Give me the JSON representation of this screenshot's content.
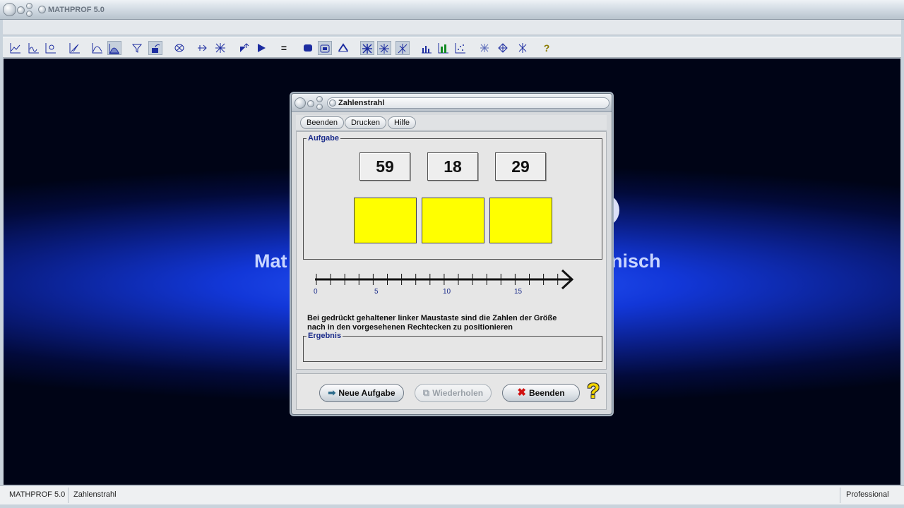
{
  "app": {
    "title": "MATHPROF 5.0"
  },
  "background": {
    "title_left": "Mat",
    "title_right": "nisch"
  },
  "toolbar": {
    "icons": [
      "graph-line-icon",
      "graph-multi-icon",
      "graph-param-icon",
      "graph-axes-icon",
      "graph-curve-icon",
      "graph-area-icon",
      "filter-icon",
      "rotate-icon",
      "ellipse-cross-icon",
      "arrow-cross-icon",
      "grid-cross-icon",
      "shape-arrow-icon",
      "play-icon",
      "equals-icon",
      "cube-icon",
      "cube-open-icon",
      "hat-icon",
      "star-cross-icon",
      "star-cross-icon-2",
      "star-cross-icon-3",
      "bar-chart-icon",
      "bar-chart-green-icon",
      "scatter-icon",
      "asterisk-icon",
      "diamond-icon",
      "star-icon",
      "help-question-icon"
    ],
    "equals_symbol": "=",
    "help_symbol": "?"
  },
  "dialog": {
    "title": "Zahlenstrahl",
    "menu": [
      "Beenden",
      "Drucken",
      "Hilfe"
    ],
    "aufgabe_legend": "Aufgabe",
    "numbers": [
      "59",
      "18",
      "29"
    ],
    "axis_labels": [
      "0",
      "5",
      "10",
      "15"
    ],
    "instruction_line1": "Bei gedrückt gehaltener linker Maustaste sind die Zahlen der Größe",
    "instruction_line2": "nach in den vorgesehenen Rechtecken zu positionieren",
    "ergebnis_legend": "Ergebnis",
    "ergebnis_value": "",
    "buttons": {
      "neue_aufgabe": "Neue Aufgabe",
      "wiederholen": "Wiederholen",
      "beenden": "Beenden"
    }
  },
  "statusbar": {
    "app": "MATHPROF 5.0",
    "module": "Zahlenstrahl",
    "edition": "Professional"
  },
  "colors": {
    "target_fill": "#ffff00",
    "legend_text": "#1a2b8a",
    "background_glow": "#2a5bff"
  }
}
